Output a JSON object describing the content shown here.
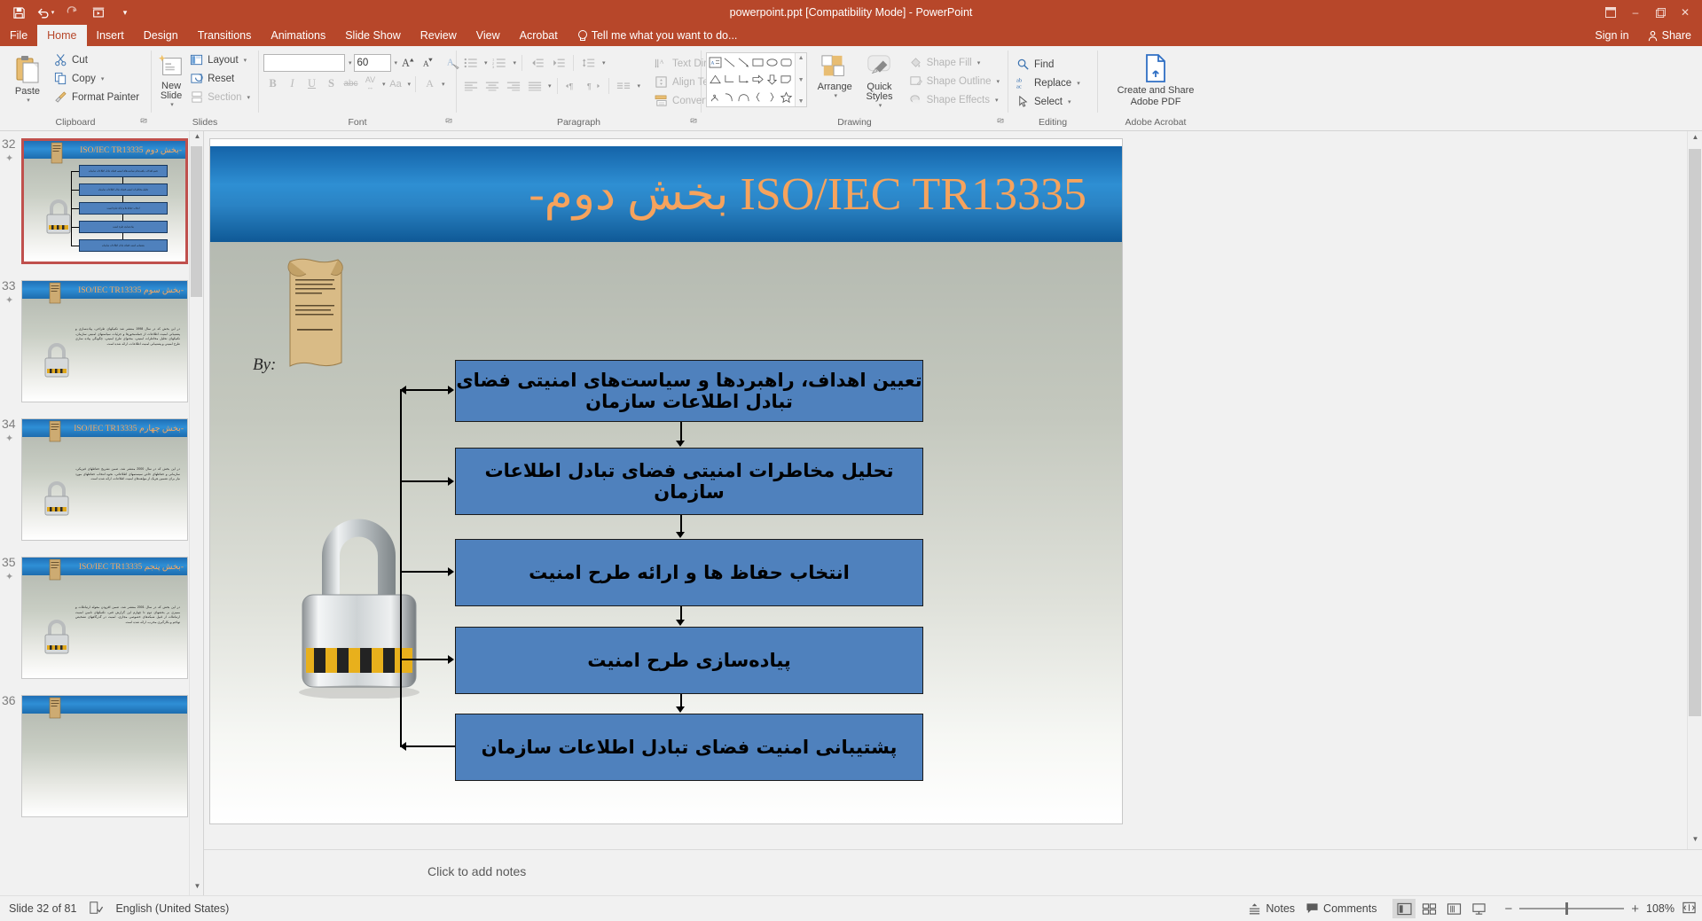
{
  "window": {
    "title": "powerpoint.ppt [Compatibility Mode] - PowerPoint",
    "qat": [
      {
        "name": "save-icon",
        "label": "Save"
      },
      {
        "name": "undo-icon",
        "label": "Undo"
      },
      {
        "name": "redo-icon",
        "label": "Redo"
      },
      {
        "name": "start-from-beginning-icon",
        "label": "Start From Beginning"
      },
      {
        "name": "customize-qat-icon",
        "label": "Customize Quick Access Toolbar"
      }
    ],
    "controls": [
      "ribbon-display-options",
      "minimize",
      "restore",
      "close"
    ]
  },
  "tabs": [
    {
      "label": "File",
      "active": false
    },
    {
      "label": "Home",
      "active": true
    },
    {
      "label": "Insert",
      "active": false
    },
    {
      "label": "Design",
      "active": false
    },
    {
      "label": "Transitions",
      "active": false
    },
    {
      "label": "Animations",
      "active": false
    },
    {
      "label": "Slide Show",
      "active": false
    },
    {
      "label": "Review",
      "active": false
    },
    {
      "label": "View",
      "active": false
    },
    {
      "label": "Acrobat",
      "active": false
    }
  ],
  "tell_me": "Tell me what you want to do...",
  "sign_in": "Sign in",
  "share": "Share",
  "ribbon": {
    "groups": [
      {
        "label": "Clipboard"
      },
      {
        "label": "Slides"
      },
      {
        "label": "Font"
      },
      {
        "label": "Paragraph"
      },
      {
        "label": "Drawing"
      },
      {
        "label": "Editing"
      },
      {
        "label": "Adobe Acrobat"
      }
    ],
    "clipboard": {
      "paste": "Paste",
      "cut": "Cut",
      "copy": "Copy",
      "format_painter": "Format Painter"
    },
    "slides": {
      "new_slide": "New\nSlide",
      "new_slide_line1": "New",
      "new_slide_line2": "Slide",
      "layout": "Layout",
      "reset": "Reset",
      "section": "Section"
    },
    "font": {
      "font_name": "",
      "font_size": "60",
      "bold": "B",
      "italic": "I",
      "underline": "U",
      "shadow": "S",
      "strikethrough": "abc",
      "character_spacing": "AV",
      "change_case": "Aa",
      "font_color": "A",
      "increase_font": "A",
      "decrease_font": "A",
      "clear_formatting": "clear-formatting"
    },
    "paragraph": {
      "text_direction": "Text Direction",
      "align_text": "Align Text",
      "convert_to_smartart": "Convert to SmartArt"
    },
    "drawing": {
      "arrange": "Arrange",
      "quick_styles_line1": "Quick",
      "quick_styles_line2": "Styles",
      "shape_fill": "Shape Fill",
      "shape_outline": "Shape Outline",
      "shape_effects": "Shape Effects"
    },
    "editing": {
      "find": "Find",
      "replace": "Replace",
      "select": "Select"
    },
    "acrobat": {
      "create_and_share_line1": "Create and Share",
      "create_and_share_line2": "Adobe PDF"
    }
  },
  "thumbnails": [
    {
      "number": "32",
      "selected": true,
      "title": "ISO/IEC TR13335 بخش دوم-",
      "type": "flow",
      "boxes": [
        "تعیین اهداف، راهبردها و سیاست‌های امنیتی فضای تبادل اطلاعات سازمان",
        "تحلیل مخاطرات امنیتی فضای تبادل اطلاعات سازمان",
        "انتخاب حفاظ ها و ارائه طرح امنیت",
        "پیاده‌سازی طرح امنیت",
        "پشتیبانی امنیت فضای تبادل اطلاعات سازمان"
      ]
    },
    {
      "number": "33",
      "selected": false,
      "title": "ISO/IEC TR13335 بخش سوم-",
      "type": "text",
      "body": "در این بخش که در سال 1998 منتشر شد تکنیکهای طراحی، پیاده‌سازی و پشتیبانی امنیت اطلاعات از جمله‌محورها و جزئیات سیاستهای امنیتی سازمان، تکنیکهای تحلیل مخاطرات امنیتی، محتوای طرح امنیتی، چگونگی پیاده سازی طرح امنیتی و پشتیبانی امنیت اطلاعات، ارائه شده است."
    },
    {
      "number": "34",
      "selected": false,
      "title": "ISO/IEC TR13335 بخش چهارم-",
      "type": "text",
      "body": "در این بخش که در سال 2000 منتشر شد، ضمن تشریح حفاظهای فیزیکی، سازمانی و حفاظهای خاص سیستمهای اطلاعاتی، نحوه انتخاب حفاظهای مورد نیاز برای تضمین هریک از مولفه‌های امنیت اطلاعات، ارائه شده است."
    },
    {
      "number": "35",
      "selected": false,
      "title": "ISO/IEC TR13335 بخش پنجم-",
      "type": "text",
      "body": "در این بخش که در سال 2001 منتشر شد، ضمن افزودن مقوله ارتباطات و ممیزی بر بخشهای دوم تا چهارم این گزارش فنی، تکنیکهای تامین امنیت ارتباطات از قبیل شبکه‌های خصوصی مجازی، امنیت در گذرگاههای تشخیص تهاجم و بکارگیری مخرب، ارائه شده است."
    },
    {
      "number": "36",
      "selected": false,
      "title": "",
      "type": "blank",
      "body": ""
    }
  ],
  "slide": {
    "title": "ISO/IEC TR13335 بخش دوم-",
    "byline": "By:",
    "flow_boxes": [
      "تعیین اهداف، راهبردها و سیاست‌های امنیتی فضای تبادل اطلاعات سازمان",
      "تحلیل مخاطرات امنیتی فضای تبادل اطلاعات سازمان",
      "انتخاب حفاظ ها و ارائه طرح امنیت",
      "پیاده‌سازی طرح امنیت",
      "پشتیبانی امنیت فضای تبادل اطلاعات سازمان"
    ],
    "colors": {
      "box_fill": "#4f81bd",
      "box_border": "#1b1b1b",
      "header_blue": "#2e8fd3",
      "title_orange": "#f6a35d"
    }
  },
  "notes": {
    "placeholder": "Click to add notes"
  },
  "status": {
    "slide_indicator": "Slide 32 of 81",
    "language": "English (United States)",
    "spellcheck_icon": "spell-check-icon",
    "notes": "Notes",
    "comments": "Comments",
    "zoom": "108%",
    "views": [
      "normal-view",
      "slide-sorter-view",
      "reading-view",
      "slide-show-view"
    ],
    "fit_to_window": "fit-slide-to-window"
  }
}
